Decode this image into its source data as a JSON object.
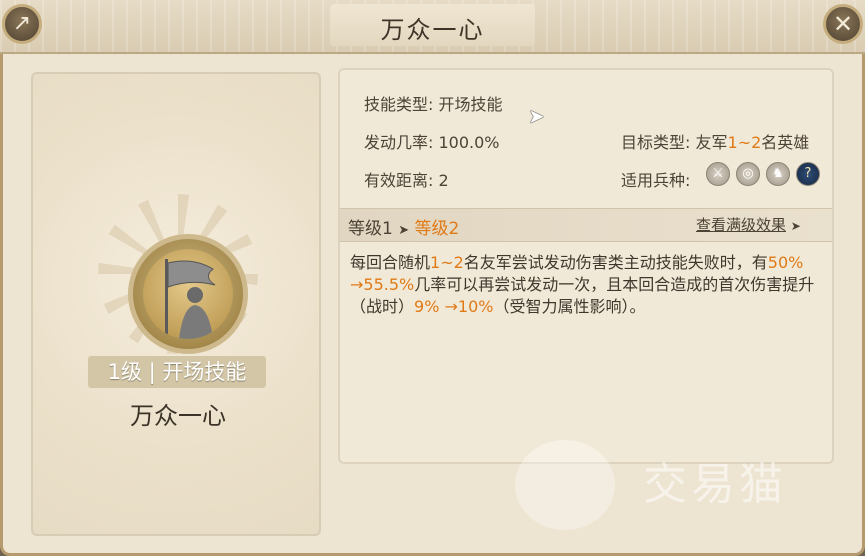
{
  "window": {
    "title": "万众一心",
    "share_icon": "↗",
    "close_icon": "✕"
  },
  "left": {
    "level_tag": "1级 | 开场技能",
    "skill_name": "万众一心"
  },
  "details": {
    "skill_type_label": "技能类型:",
    "skill_type_value": "开场技能",
    "trigger_rate_label": "发动几率:",
    "trigger_rate_value": "100.0%",
    "range_label": "有效距离:",
    "range_value": "2",
    "target_label": "目标类型:",
    "target_prefix": "友军",
    "target_count": "1~2",
    "target_suffix": "名英雄",
    "troop_label": "适用兵种:",
    "troop_icons": [
      {
        "name": "sword-icon",
        "glyph": "⚔"
      },
      {
        "name": "bow-icon",
        "glyph": "◎"
      },
      {
        "name": "cavalry-icon",
        "glyph": "♞"
      },
      {
        "name": "unknown-icon",
        "glyph": "?"
      }
    ]
  },
  "level_bar": {
    "level1": "等级1",
    "arrow": "➤",
    "level2": "等级2",
    "max_effect": "查看满级效果",
    "max_arrow": "➤"
  },
  "description": {
    "p1": "每回合随机",
    "n1": "1~2",
    "p2": "名友军尝试发动伤害类主动技能失败时，有",
    "n2": "50% →55.5%",
    "p3": "几率可以再尝试发动一次，且本回合造成的首次伤害提升（战时）",
    "n3": "9% →10%",
    "p4": "（受智力属性影响）。"
  },
  "watermark": {
    "text": "交易猫"
  },
  "colors": {
    "highlight": "#e07a16",
    "panel": "#f1e9d8",
    "frame": "#ede4d1"
  }
}
